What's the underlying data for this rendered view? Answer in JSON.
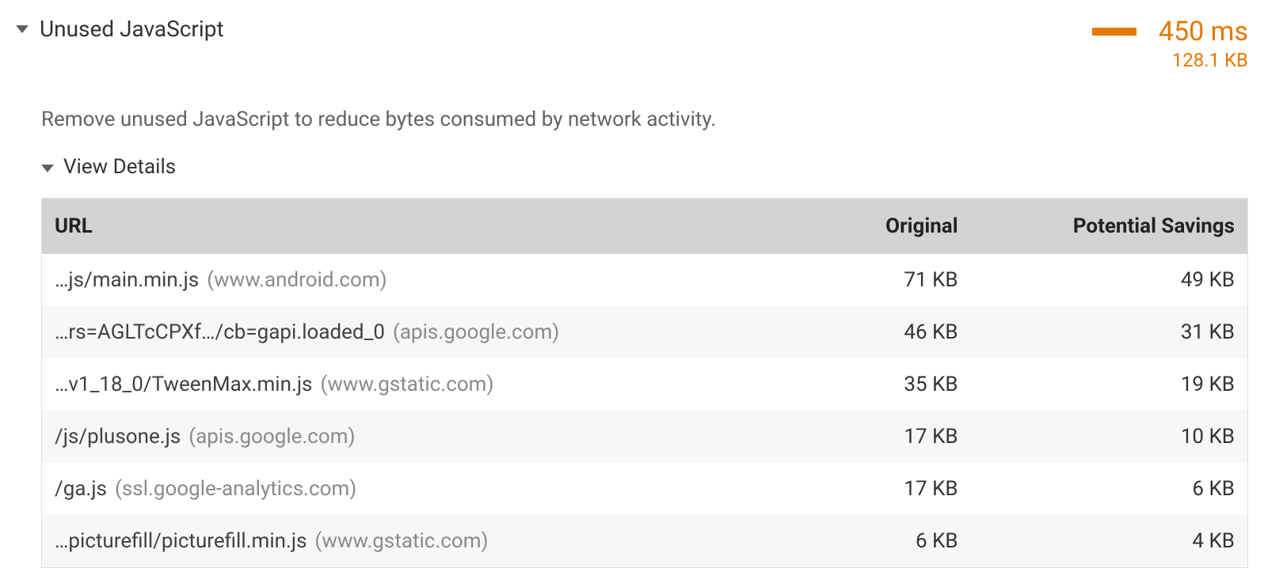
{
  "audit": {
    "title": "Unused JavaScript",
    "time": "450 ms",
    "size": "128.1 KB",
    "description": "Remove unused JavaScript to reduce bytes consumed by network activity.",
    "viewDetailsLabel": "View Details",
    "columns": {
      "url": "URL",
      "original": "Original",
      "savings": "Potential Savings"
    },
    "rows": [
      {
        "path": "…js/main.min.js",
        "domain": "(www.android.com)",
        "original": "71 KB",
        "savings": "49 KB"
      },
      {
        "path": "…rs=AGLTcCPXf…/cb=gapi.loaded_0",
        "domain": "(apis.google.com)",
        "original": "46 KB",
        "savings": "31 KB"
      },
      {
        "path": "…v1_18_0/TweenMax.min.js",
        "domain": "(www.gstatic.com)",
        "original": "35 KB",
        "savings": "19 KB"
      },
      {
        "path": "/js/plusone.js",
        "domain": "(apis.google.com)",
        "original": "17 KB",
        "savings": "10 KB"
      },
      {
        "path": "/ga.js",
        "domain": "(ssl.google-analytics.com)",
        "original": "17 KB",
        "savings": "6 KB"
      },
      {
        "path": "…picturefill/picturefill.min.js",
        "domain": "(www.gstatic.com)",
        "original": "6 KB",
        "savings": "4 KB"
      }
    ]
  }
}
